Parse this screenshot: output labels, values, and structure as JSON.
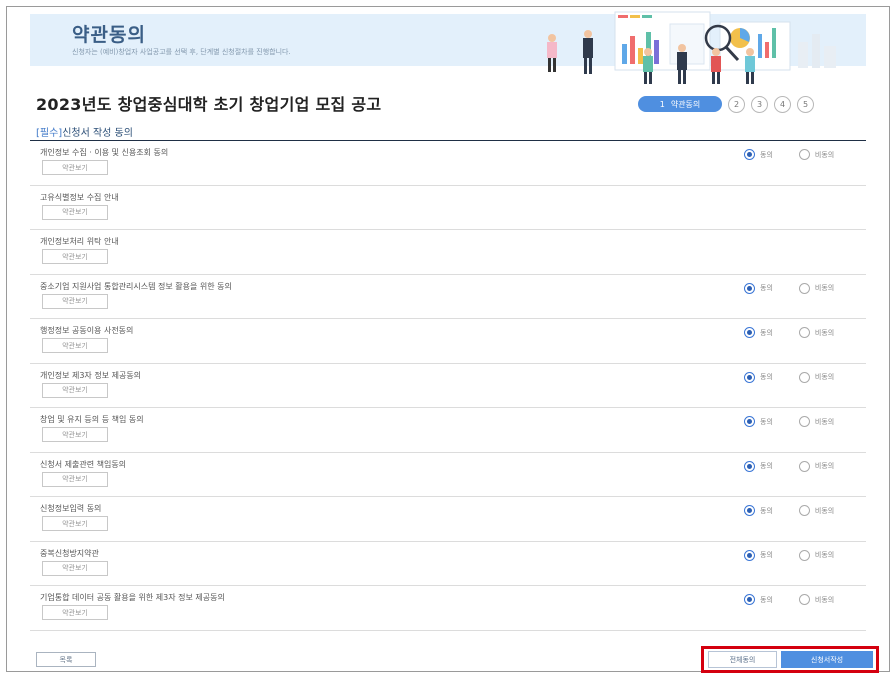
{
  "banner": {
    "title": "약관동의",
    "subtitle": "신청자는 (예비)창업자 사업공고를 선택 후, 단계별 신청절차를 진행합니다."
  },
  "page_title": "2023년도 창업중심대학 초기 창업기업 모집 공고",
  "steps": {
    "active_number": "1",
    "active_label": "약관동의",
    "others": [
      "2",
      "3",
      "4",
      "5"
    ]
  },
  "section": {
    "required_tag": "[필수]",
    "title": "신청서 작성 동의"
  },
  "radio_labels": {
    "agree": "동의",
    "disagree": "비동의"
  },
  "view_label": "약관보기",
  "rows": [
    {
      "label": "개인정보 수집 · 이용 및 신용조회 동의",
      "has_radio": true,
      "agreed": true
    },
    {
      "label": "고유식별정보 수집 안내",
      "has_radio": false,
      "agreed": false
    },
    {
      "label": "개인정보처리 위탁 안내",
      "has_radio": false,
      "agreed": false
    },
    {
      "label": "중소기업 지원사업 통합관리시스템 정보 활용을 위한 동의",
      "has_radio": true,
      "agreed": true
    },
    {
      "label": "행정정보 공동이용 사전동의",
      "has_radio": true,
      "agreed": true
    },
    {
      "label": "개인정보 제3자 정보 제공동의",
      "has_radio": true,
      "agreed": true
    },
    {
      "label": "창업 및 유지 등의 등 책임 동의",
      "has_radio": true,
      "agreed": true
    },
    {
      "label": "신청서 제출관련 책임동의",
      "has_radio": true,
      "agreed": true
    },
    {
      "label": "신청정보입력 동의",
      "has_radio": true,
      "agreed": true
    },
    {
      "label": "중복신청방지약관",
      "has_radio": true,
      "agreed": true
    },
    {
      "label": "기업통합 데이터 공동 활용을 위한 제3자 정보 제공동의",
      "has_radio": true,
      "agreed": true
    }
  ],
  "buttons": {
    "list": "목록",
    "agree_all": "전체동의",
    "apply": "신청서작성"
  },
  "colors": {
    "accent": "#4f8fe0",
    "banner_bg": "#e3f0fb",
    "highlight": "#d4000f"
  }
}
